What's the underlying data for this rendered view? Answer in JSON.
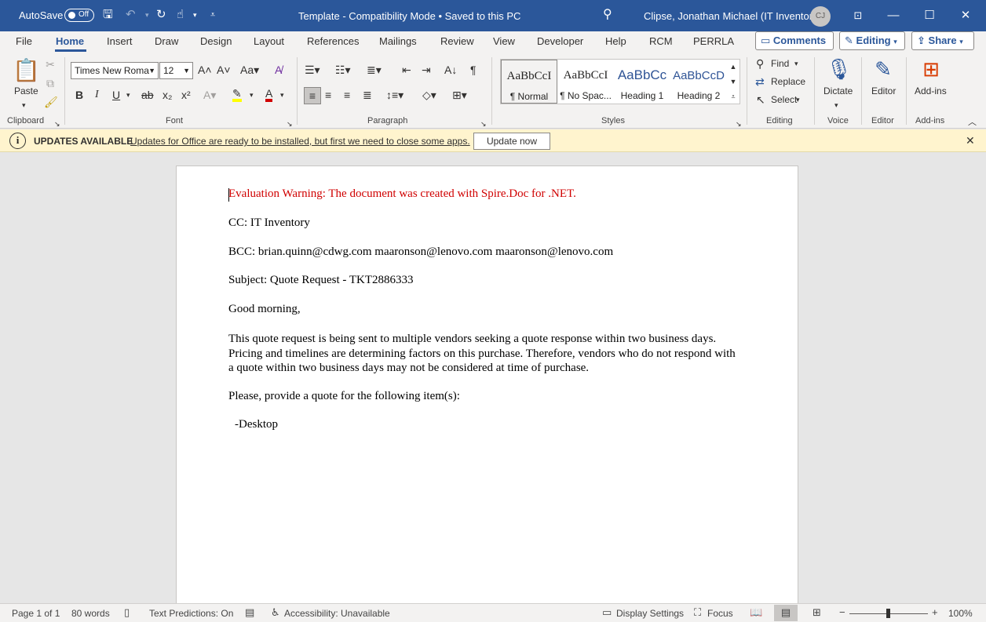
{
  "titlebar": {
    "autosave_label": "AutoSave",
    "autosave_state": "Off",
    "document_title": "Template  -  Compatibility Mode  •  Saved to this PC",
    "user_name": "Clipse, Jonathan Michael (IT Inventory)",
    "user_initials": "CJ"
  },
  "tabs": [
    "File",
    "Home",
    "Insert",
    "Draw",
    "Design",
    "Layout",
    "References",
    "Mailings",
    "Review",
    "View",
    "Developer",
    "Help",
    "RCM",
    "PERRLA"
  ],
  "actions": {
    "comments": "Comments",
    "editing": "Editing",
    "share": "Share"
  },
  "ribbon": {
    "clipboard": {
      "label": "Clipboard",
      "paste": "Paste"
    },
    "font": {
      "label": "Font",
      "family": "Times New Roma",
      "size": "12"
    },
    "paragraph": {
      "label": "Paragraph"
    },
    "styles": {
      "label": "Styles",
      "items": [
        {
          "sample": "AaBbCcI",
          "name": "¶ Normal"
        },
        {
          "sample": "AaBbCcI",
          "name": "¶ No Spac..."
        },
        {
          "sample": "AaBbCc",
          "name": "Heading 1"
        },
        {
          "sample": "AaBbCcD",
          "name": "Heading 2"
        }
      ]
    },
    "editing": {
      "label": "Editing",
      "find": "Find",
      "replace": "Replace",
      "select": "Select"
    },
    "voice": {
      "label": "Voice",
      "dictate": "Dictate"
    },
    "editor": {
      "label": "Editor",
      "button": "Editor"
    },
    "addins": {
      "label": "Add-ins",
      "button": "Add-ins"
    }
  },
  "infobar": {
    "title": "UPDATES AVAILABLE",
    "message": "Updates for Office are ready to be installed, but first we need to close some apps.",
    "button": "Update now"
  },
  "document": {
    "warning": "Evaluation Warning: The document was created with Spire.Doc for .NET.",
    "cc": "CC: IT Inventory",
    "bcc": "BCC: brian.quinn@cdwg.com maaronson@lenovo.com maaronson@lenovo.com",
    "subject": "Subject: Quote Request - TKT2886333",
    "greeting": "Good morning,",
    "body": "This quote request is being sent to multiple vendors seeking a quote response within two business days. Pricing and timelines are determining factors on this purchase. Therefore, vendors who do not respond with a quote within two business days may not be considered at time of purchase.",
    "request": "Please, provide a quote for the following item(s):",
    "item": "-Desktop"
  },
  "statusbar": {
    "page": "Page 1 of 1",
    "words": "80 words",
    "predictions": "Text Predictions: On",
    "accessibility": "Accessibility: Unavailable",
    "display": "Display Settings",
    "focus": "Focus",
    "zoom": "100%"
  }
}
